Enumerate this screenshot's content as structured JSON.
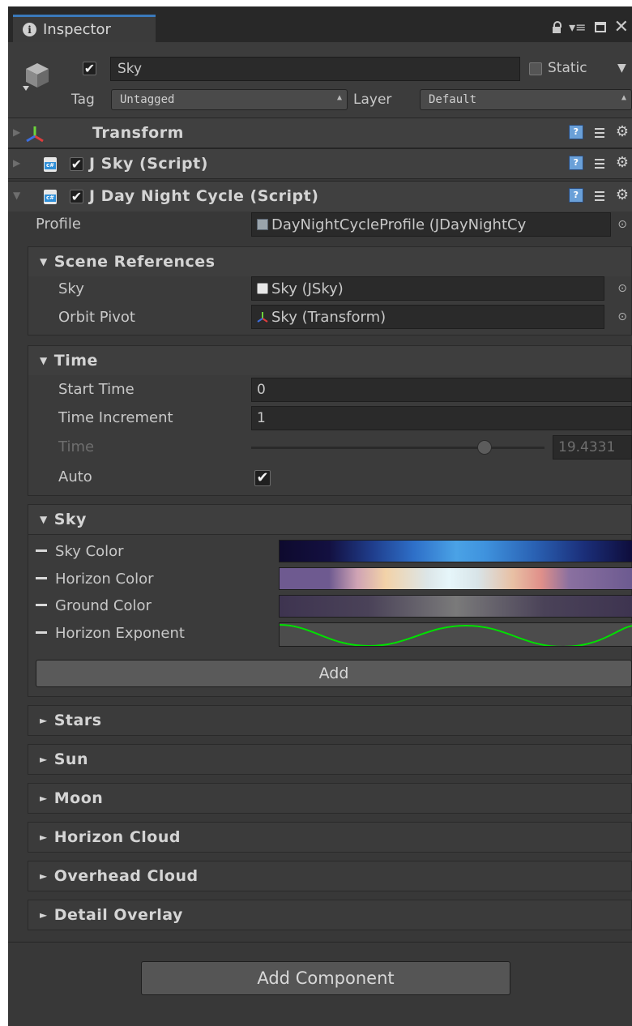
{
  "window": {
    "tab_label": "Inspector",
    "icons": [
      "info-icon",
      "lock-icon",
      "menu-icon",
      "maximize-icon",
      "close-icon"
    ]
  },
  "gameobject": {
    "active": true,
    "name": "Sky",
    "static_label": "Static",
    "static": false,
    "tag_label": "Tag",
    "tag_value": "Untagged",
    "layer_label": "Layer",
    "layer_value": "Default"
  },
  "components": {
    "transform": {
      "title": "Transform",
      "expanded": false
    },
    "jsky": {
      "title": "J Sky (Script)",
      "enabled": true,
      "expanded": false
    },
    "daynight": {
      "title": "J Day Night Cycle (Script)",
      "enabled": true,
      "expanded": true
    }
  },
  "daynight": {
    "profile_label": "Profile",
    "profile_value": "DayNightCycleProfile (JDayNightCy",
    "scene_refs": {
      "title": "Scene References",
      "sky_label": "Sky",
      "sky_value": "Sky (JSky)",
      "orbit_label": "Orbit Pivot",
      "orbit_value": "Sky (Transform)"
    },
    "time": {
      "title": "Time",
      "start_label": "Start Time",
      "start_value": "0",
      "increment_label": "Time Increment",
      "increment_value": "1",
      "time_label": "Time",
      "time_value": "19.4331",
      "slider_fraction": 0.81,
      "auto_label": "Auto",
      "auto": true
    },
    "sky": {
      "title": "Sky",
      "props": [
        "Sky Color",
        "Horizon Color",
        "Ground Color",
        "Horizon Exponent"
      ],
      "add_label": "Add"
    },
    "collapsed_groups": [
      "Stars",
      "Sun",
      "Moon",
      "Horizon Cloud",
      "Overhead Cloud",
      "Detail Overlay"
    ]
  },
  "footer": {
    "add_component_label": "Add Component"
  },
  "colors": {
    "panel_bg": "#383838",
    "tab_accent": "#3a79bb",
    "curve_green": "#00e000"
  }
}
